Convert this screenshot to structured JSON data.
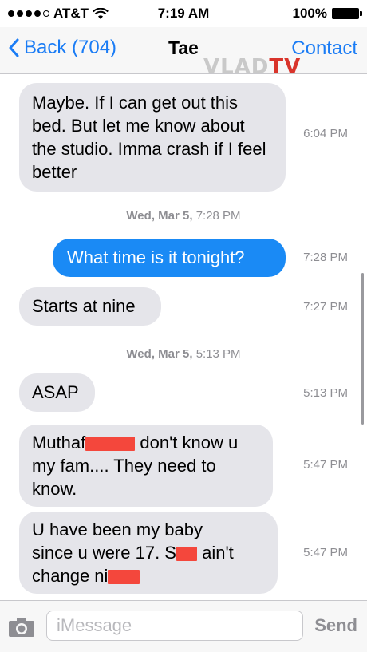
{
  "status_bar": {
    "carrier": "AT&T",
    "time": "7:19 AM",
    "battery": "100%"
  },
  "nav": {
    "back_label": "Back (704)",
    "title": "Tae",
    "contact_label": "Contact"
  },
  "watermark": {
    "part1": "VLAD",
    "part2": "TV"
  },
  "messages": [
    {
      "text": "Maybe. If I can get out this bed. But let me know about the studio. Imma crash if I feel better",
      "time": "6:04 PM"
    },
    {
      "separator": "Wed, Mar 5,",
      "separator_time": "7:28 PM"
    },
    {
      "text": "What time is it tonight?",
      "time": "7:28 PM"
    },
    {
      "text": "Starts at nine",
      "time": "7:27 PM"
    },
    {
      "separator": "Wed, Mar 5,",
      "separator_time": "5:13 PM"
    },
    {
      "text": "ASAP",
      "time": "5:13 PM"
    },
    {
      "text_a": "Muthaf",
      "text_b": "don't know u",
      "text_c": "my fam.... They need to",
      "text_d": "know.",
      "time": "5:47 PM"
    },
    {
      "text_a": "U have been my baby",
      "text_b": "since u were 17. S",
      "text_c": "ain't",
      "text_d": "change ni",
      "time": "5:47 PM"
    }
  ],
  "input": {
    "placeholder": "iMessage",
    "value": "",
    "send_label": "Send"
  },
  "icons": {
    "back": "chevron-left-icon",
    "camera": "camera-icon",
    "wifi": "wifi-icon",
    "battery": "battery-icon"
  },
  "colors": {
    "accent": "#1a7cf5",
    "sent_bubble": "#1a8af5",
    "received_bubble": "#e5e5ea",
    "redaction": "#f4473c"
  }
}
